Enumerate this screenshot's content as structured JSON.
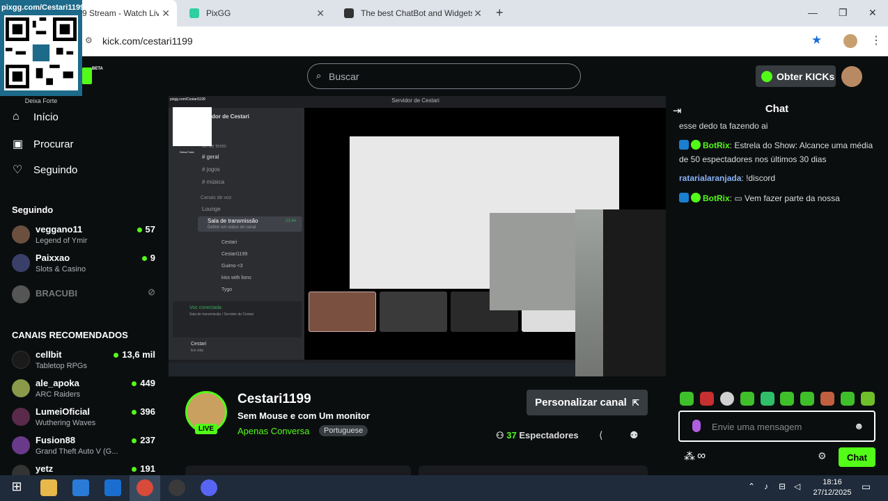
{
  "browser": {
    "tabs": [
      {
        "label": "9 Stream - Watch Liv",
        "favicon_color": "#53fc18"
      },
      {
        "label": "PixGG",
        "favicon_color": "#2fcfa0"
      },
      {
        "label": "The best ChatBot and Widgets f",
        "favicon_color": "#333333"
      }
    ],
    "new_tab": "+",
    "address": "kick.com/cestari1199"
  },
  "overlay": {
    "qr_label": "pixgg.com/Cestari1199",
    "qr_caption": "Deixa Forte"
  },
  "header": {
    "brand_tag": "BETA",
    "search_placeholder": "Buscar",
    "kicks_button": "Obter KICKs"
  },
  "sidebar": {
    "nav": [
      {
        "label": "Início",
        "icon": "home-icon"
      },
      {
        "label": "Procurar",
        "icon": "browse-icon"
      },
      {
        "label": "Seguindo",
        "icon": "heart-icon"
      }
    ],
    "following_title": "Seguindo",
    "following": [
      {
        "name": "veggano11",
        "game": "Legend of Ymir",
        "viewers": "57",
        "color": "#6b5040"
      },
      {
        "name": "Paixxao",
        "game": "Slots & Casino",
        "viewers": "9",
        "color": "#3a3f6a"
      },
      {
        "name": "BRACUBI",
        "game": "",
        "viewers": "",
        "color": "#555555"
      }
    ],
    "recommended_title": "CANAIS RECOMENDADOS",
    "recommended": [
      {
        "name": "cellbit",
        "game": "Tabletop RPGs",
        "viewers": "13,6 mil",
        "color": "#1a1a1a"
      },
      {
        "name": "ale_apoka",
        "game": "ARC Raiders",
        "viewers": "449",
        "color": "#8a9a4a"
      },
      {
        "name": "LumeiOficial",
        "game": "Wuthering Waves",
        "viewers": "396",
        "color": "#5a2a4a"
      },
      {
        "name": "Fusion88",
        "game": "Grand Theft Auto V (G...",
        "viewers": "237",
        "color": "#6a3a8a"
      },
      {
        "name": "yetz",
        "game": "",
        "viewers": "191",
        "color": "#333333"
      }
    ]
  },
  "player": {
    "discord_title": "Servidor de Cestari",
    "server_name": "dor de Cestari",
    "text_channels_header": "do de texto",
    "channels": [
      "geral",
      "jogos",
      "música"
    ],
    "voice_header": "Canais de voz",
    "voice_channels": [
      "Lounge",
      "Sala de transmissão"
    ],
    "voice_subtext": "Definir um status do canal",
    "voice_time": "23:44",
    "voice_users": [
      "Cestari",
      "Cestari1199",
      "Guimo <3",
      "kiss with lions",
      "Tygo"
    ],
    "voice_connected": "Voz conectada",
    "voice_connected_sub": "Sala de transmissão / Servidor de Cestari",
    "user_name": "Cestari",
    "user_status": "Em vida",
    "mini_qr_label": "pixgg.com/Cestari1199",
    "mini_qr_caption": "Deixa Forte"
  },
  "stream": {
    "name": "Cestari1199",
    "title": "Sem Mouse e com Um monitor",
    "category": "Apenas Conversa",
    "language": "Portuguese",
    "live_badge": "LIVE",
    "customize_button": "Personalizar canal",
    "viewers_count": "37",
    "viewers_label": "Espectadores"
  },
  "chat": {
    "header": "Chat",
    "messages": [
      {
        "user": "",
        "text": "esse dedo ta fazendo ai",
        "color": "#dddddd",
        "badges": false
      },
      {
        "user": "BotRix",
        "text": "Estrela do Show: Alcance uma média de 50 espectadores nos últimos 30 dias",
        "color": "#53fc18",
        "badges": true
      },
      {
        "user": "ratarialaranjada",
        "text": "!discord",
        "color": "#8ab4f8",
        "badges": false
      },
      {
        "user": "BotRix",
        "text": "Vem fazer parte da nossa",
        "color": "#53fc18",
        "badges": true
      }
    ],
    "input_placeholder": "Envie uma mensagem",
    "send_button": "Chat",
    "points": "∞"
  },
  "taskbar": {
    "time": "18:16",
    "date": "27/12/2025"
  }
}
